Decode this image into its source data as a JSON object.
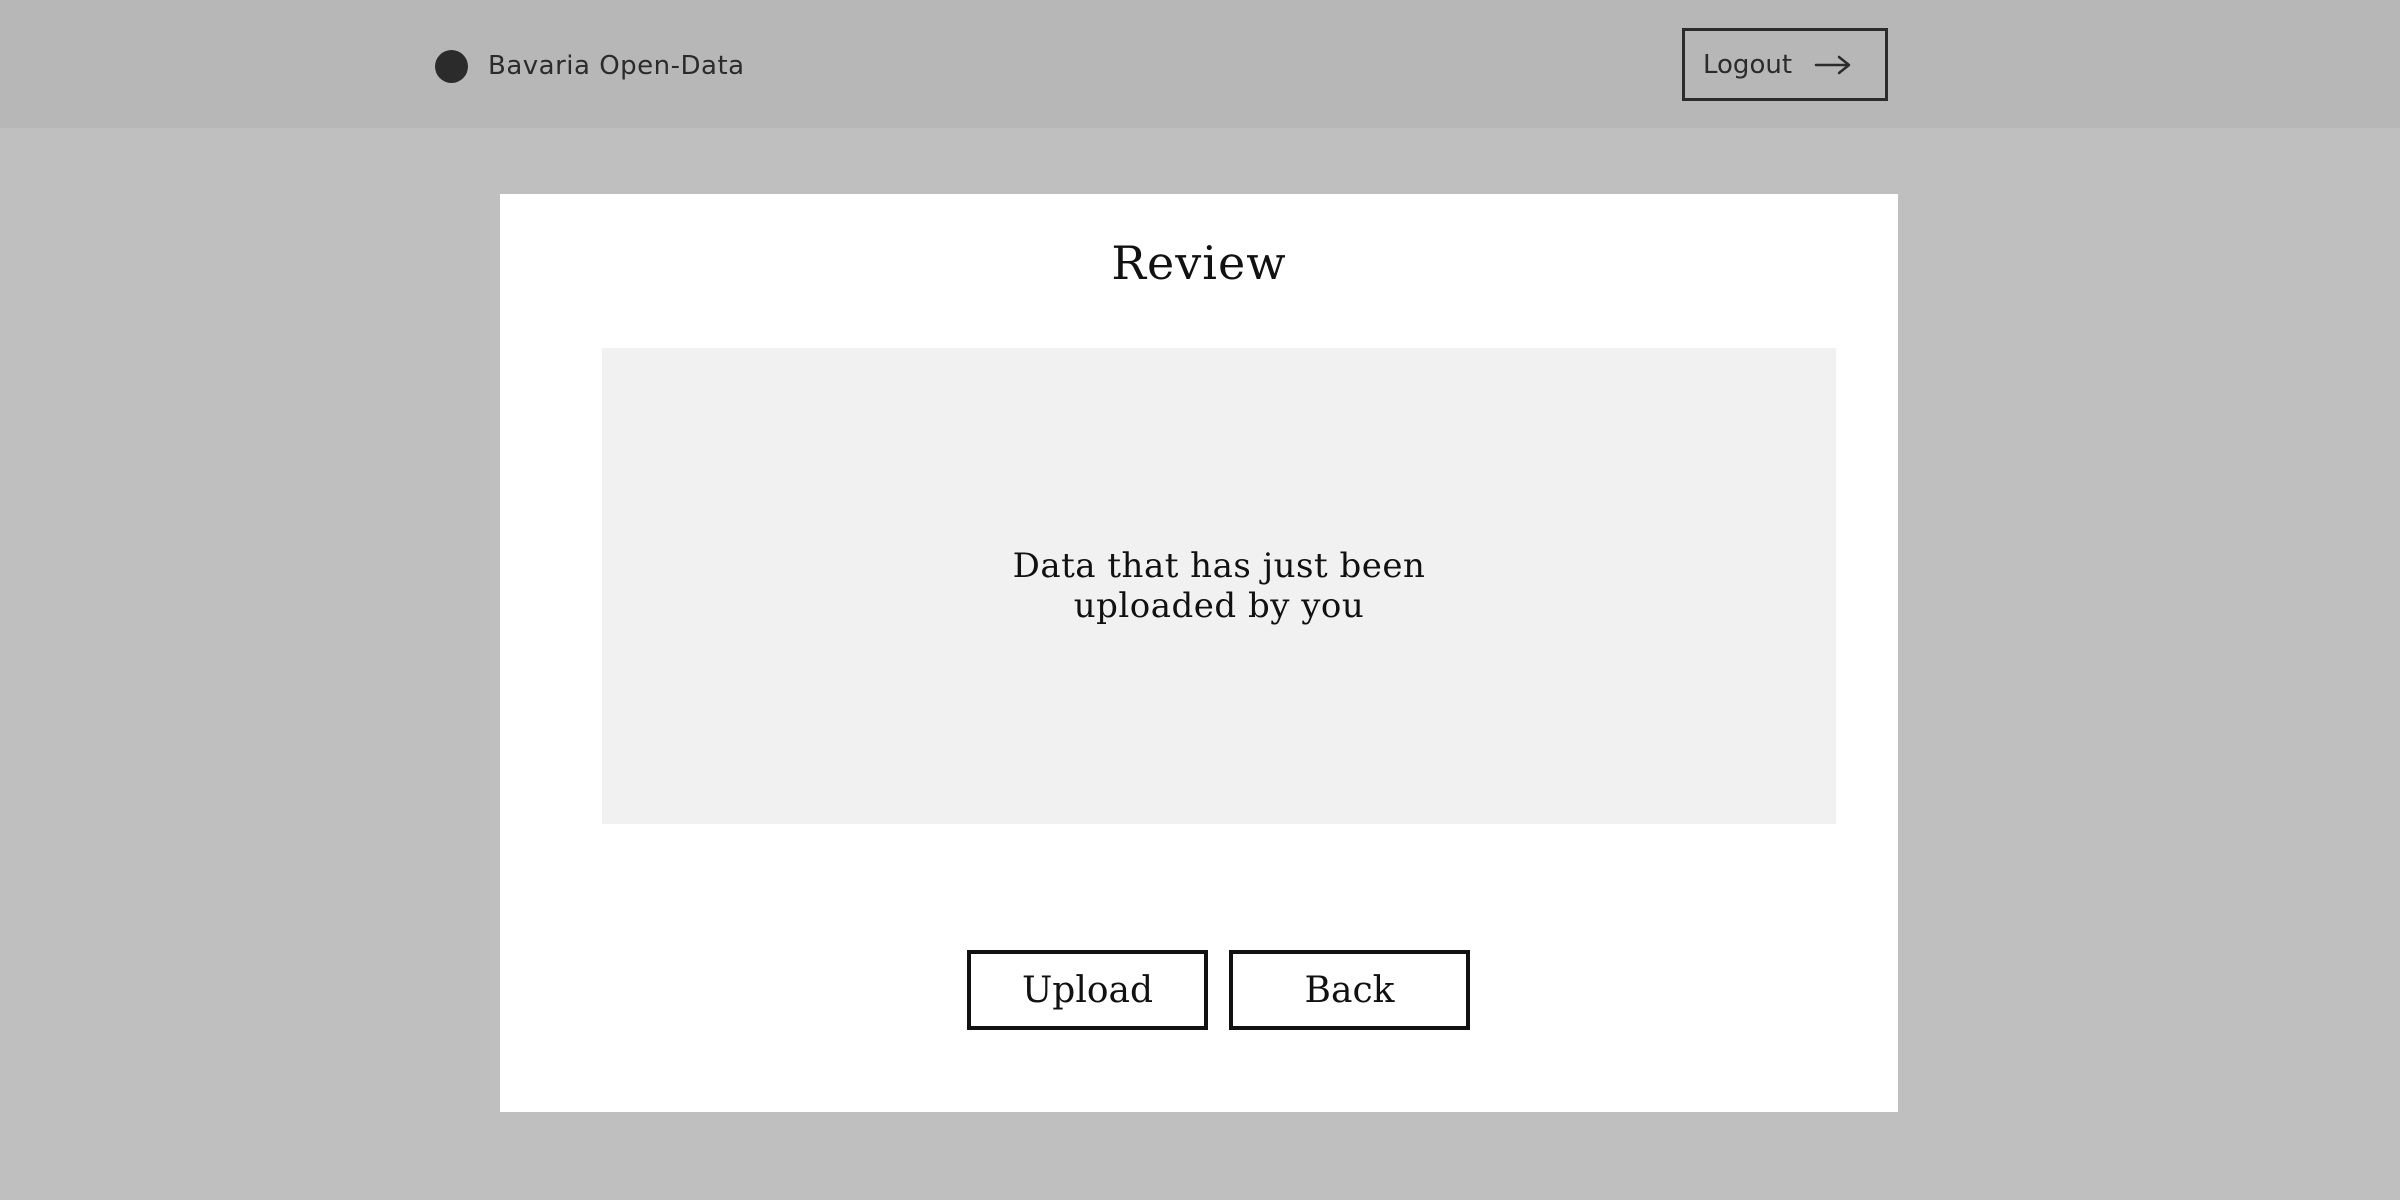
{
  "header": {
    "brand_name": "Bavaria Open-Data",
    "logout_label": "Logout",
    "logout_icon": "arrow-right-icon"
  },
  "review": {
    "title": "Review",
    "data_placeholder": "Data that has just been uploaded by you",
    "upload_label": "Upload",
    "back_label": "Back"
  },
  "colors": {
    "page_background": "#bfbfbf",
    "header_background": "#b7b7b7",
    "card_background": "#ffffff",
    "panel_background": "#f1f1f1",
    "ink": "#111111"
  }
}
